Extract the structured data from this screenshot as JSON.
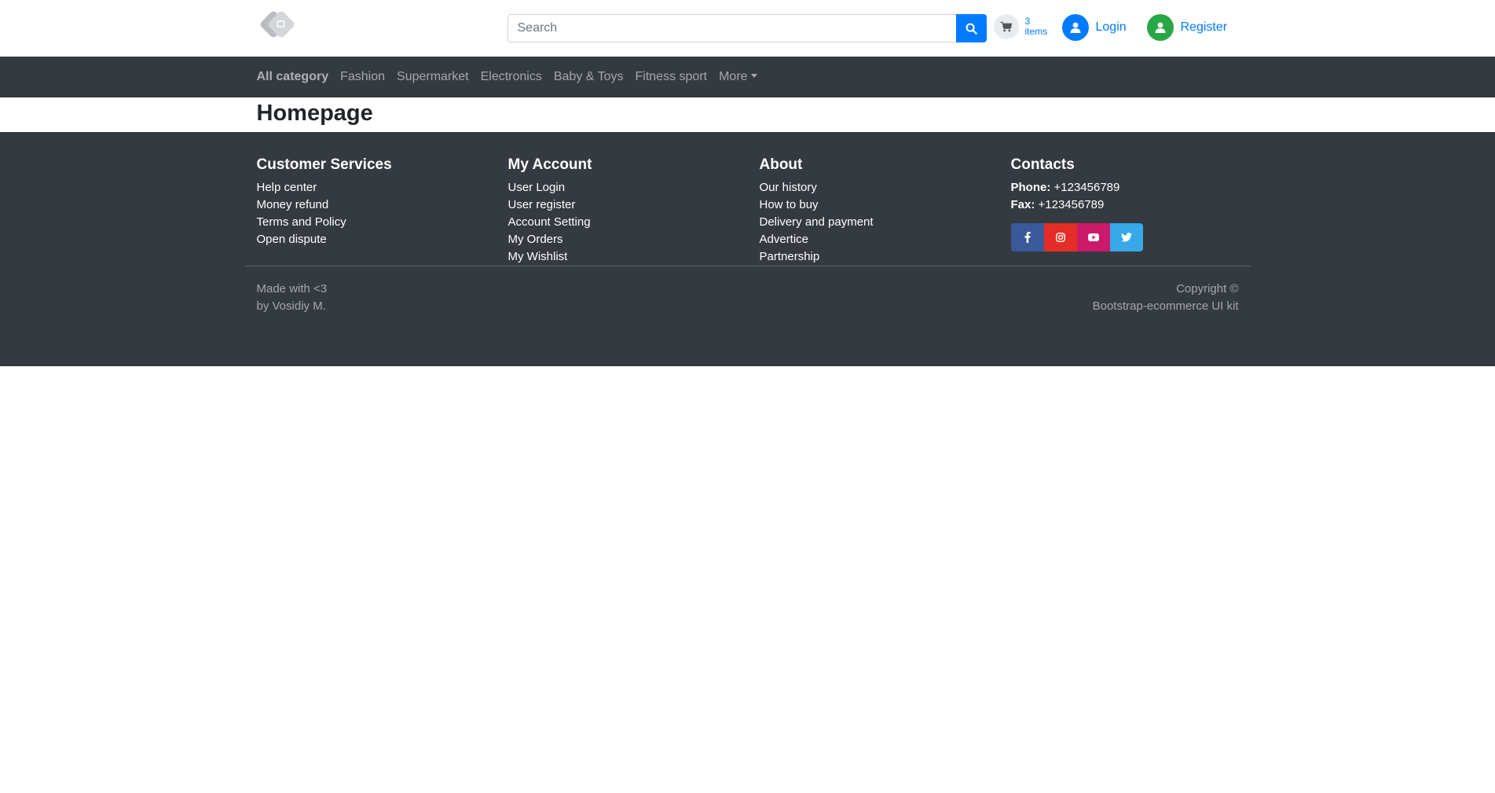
{
  "header": {
    "search_placeholder": "Search",
    "cart": {
      "count": "3",
      "label": "items"
    },
    "login_label": "Login",
    "register_label": "Register"
  },
  "nav": {
    "items": [
      {
        "label": "All category"
      },
      {
        "label": "Fashion"
      },
      {
        "label": "Supermarket"
      },
      {
        "label": "Electronics"
      },
      {
        "label": "Baby & Toys"
      },
      {
        "label": "Fitness sport"
      },
      {
        "label": "More"
      }
    ]
  },
  "page": {
    "title": "Homepage"
  },
  "footer": {
    "columns": [
      {
        "title": "Customer Services",
        "links": [
          "Help center",
          "Money refund",
          "Terms and Policy",
          "Open dispute"
        ]
      },
      {
        "title": "My Account",
        "links": [
          "User Login",
          "User register",
          "Account Setting",
          "My Orders",
          "My Wishlist"
        ]
      },
      {
        "title": "About",
        "links": [
          "Our history",
          "How to buy",
          "Delivery and payment",
          "Advertice",
          "Partnership"
        ]
      }
    ],
    "contacts": {
      "title": "Contacts",
      "phone_label": "Phone:",
      "phone": "+123456789",
      "fax_label": "Fax:",
      "fax": "+123456789"
    },
    "social": [
      {
        "icon": "facebook-icon",
        "color": "#3b5998"
      },
      {
        "icon": "instagram-icon",
        "color": "#e52d27"
      },
      {
        "icon": "youtube-icon",
        "color": "#cc1a6a"
      },
      {
        "icon": "twitter-icon",
        "color": "#37a8e8"
      }
    ],
    "bottom_left": [
      "Made with <3",
      "by Vosidiy M."
    ],
    "bottom_right": [
      "Copyright ©",
      "Bootstrap-ecommerce UI kit"
    ]
  },
  "colors": {
    "accent": "#007bff",
    "success": "#28a745",
    "dark": "#343a40"
  }
}
